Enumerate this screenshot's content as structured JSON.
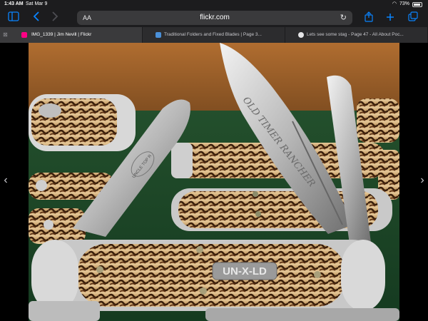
{
  "status_bar": {
    "time": "1:43 AM",
    "date": "Sat Mar 9",
    "battery": "73%"
  },
  "toolbar": {
    "text_size_label": "AA",
    "url": "flickr.com"
  },
  "tabs": [
    {
      "label": "IMG_1339 | Jim Nevill | Flickr",
      "active": true,
      "favicon_color": "#ff0084"
    },
    {
      "label": "Traditional Folders and Fixed Blades | Page 3...",
      "active": false,
      "favicon_color": "#4a90d9"
    },
    {
      "label": "Lets see some stag - Page 47 - All About Poc...",
      "active": false,
      "favicon_color": "#e5e5e7"
    }
  ],
  "photo": {
    "blade_etch_large": "OLD TIMER RANCHER",
    "blade_stamp_left": "UNCLE TOP R",
    "shield_text": "UN-X-LD"
  },
  "colors": {
    "accent": "#0a84ff",
    "stag_dark": "#3a1f0c",
    "stag_light": "#d9b98a",
    "felt_green": "#1e4a2a"
  }
}
